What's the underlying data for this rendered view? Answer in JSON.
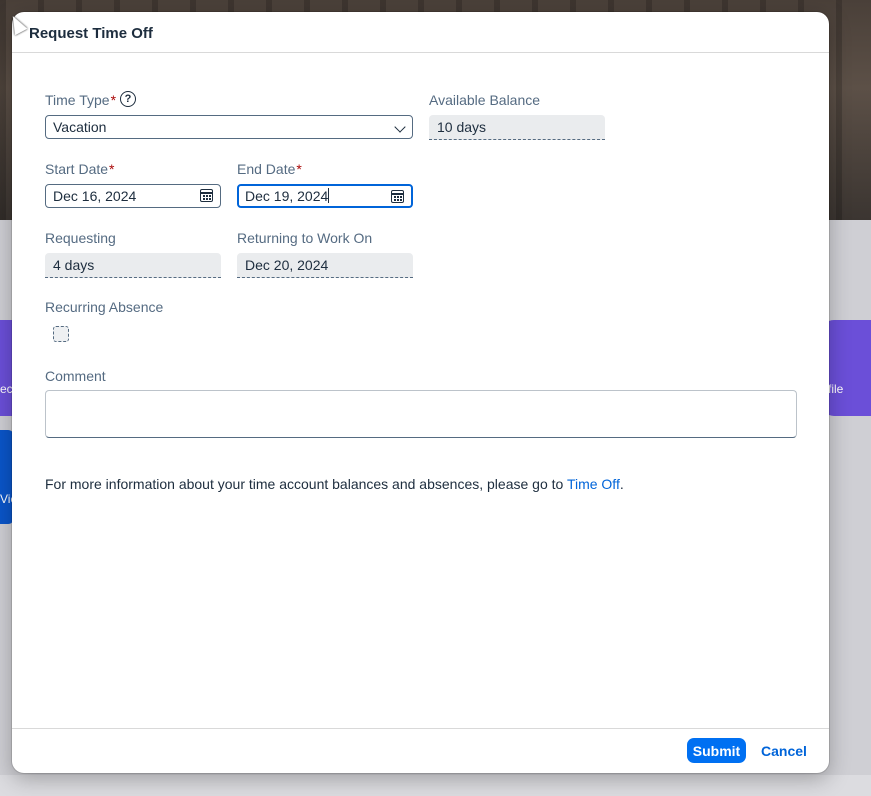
{
  "background": {
    "left_tile_text": "ec",
    "right_tile_text": "file",
    "blue_tile_text": "Vie"
  },
  "dialog": {
    "title": "Request Time Off",
    "time_type": {
      "label": "Time Type",
      "required_mark": "*",
      "value": "Vacation"
    },
    "available_balance": {
      "label": "Available Balance",
      "value": "10 days"
    },
    "start_date": {
      "label": "Start Date",
      "required_mark": "*",
      "value": "Dec 16, 2024"
    },
    "end_date": {
      "label": "End Date",
      "required_mark": "*",
      "value": "Dec 19, 2024"
    },
    "requesting": {
      "label": "Requesting",
      "value": "4 days"
    },
    "returning": {
      "label": "Returning to Work On",
      "value": "Dec 20, 2024"
    },
    "recurring": {
      "label": "Recurring Absence",
      "checked": false
    },
    "comment": {
      "label": "Comment",
      "value": ""
    },
    "info": {
      "text": "For more information about your time account balances and absences, please go to ",
      "link": "Time Off",
      "suffix": "."
    },
    "footer": {
      "submit_label": "Submit",
      "cancel_label": "Cancel"
    }
  },
  "colors": {
    "primary": "#0070f2",
    "link": "#0064d9",
    "required": "#aa0808",
    "label": "#556b82",
    "text": "#1d2d3e"
  },
  "icons": [
    "help-icon",
    "chevron-down-icon",
    "calendar-icon",
    "mouse-cursor"
  ]
}
